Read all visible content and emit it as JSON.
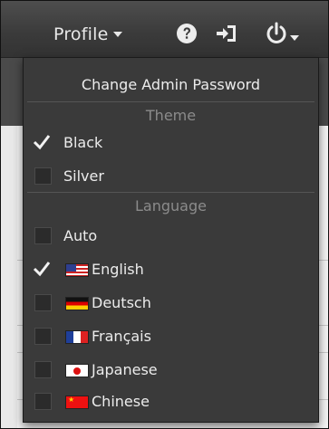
{
  "header": {
    "profile_label": "Profile",
    "icons": [
      "help-icon",
      "logout-icon",
      "power-icon"
    ]
  },
  "menu": {
    "change_password": "Change Admin Password",
    "theme_header": "Theme",
    "themes": [
      {
        "label": "Black",
        "checked": true
      },
      {
        "label": "Silver",
        "checked": false
      }
    ],
    "language_header": "Language",
    "languages": [
      {
        "label": "Auto",
        "checked": false,
        "flag": null
      },
      {
        "label": "English",
        "checked": true,
        "flag": "us-flag-icon"
      },
      {
        "label": "Deutsch",
        "checked": false,
        "flag": "germany-flag-icon"
      },
      {
        "label": "Français",
        "checked": false,
        "flag": "france-flag-icon"
      },
      {
        "label": "Japanese",
        "checked": false,
        "flag": "japan-flag-icon"
      },
      {
        "label": "Chinese",
        "checked": false,
        "flag": "china-flag-icon"
      }
    ]
  },
  "colors": {
    "menu_bg": "#3a3a3a",
    "topbar_bg": "#404040",
    "text": "#ececec",
    "section_header": "#8b8b8b"
  }
}
